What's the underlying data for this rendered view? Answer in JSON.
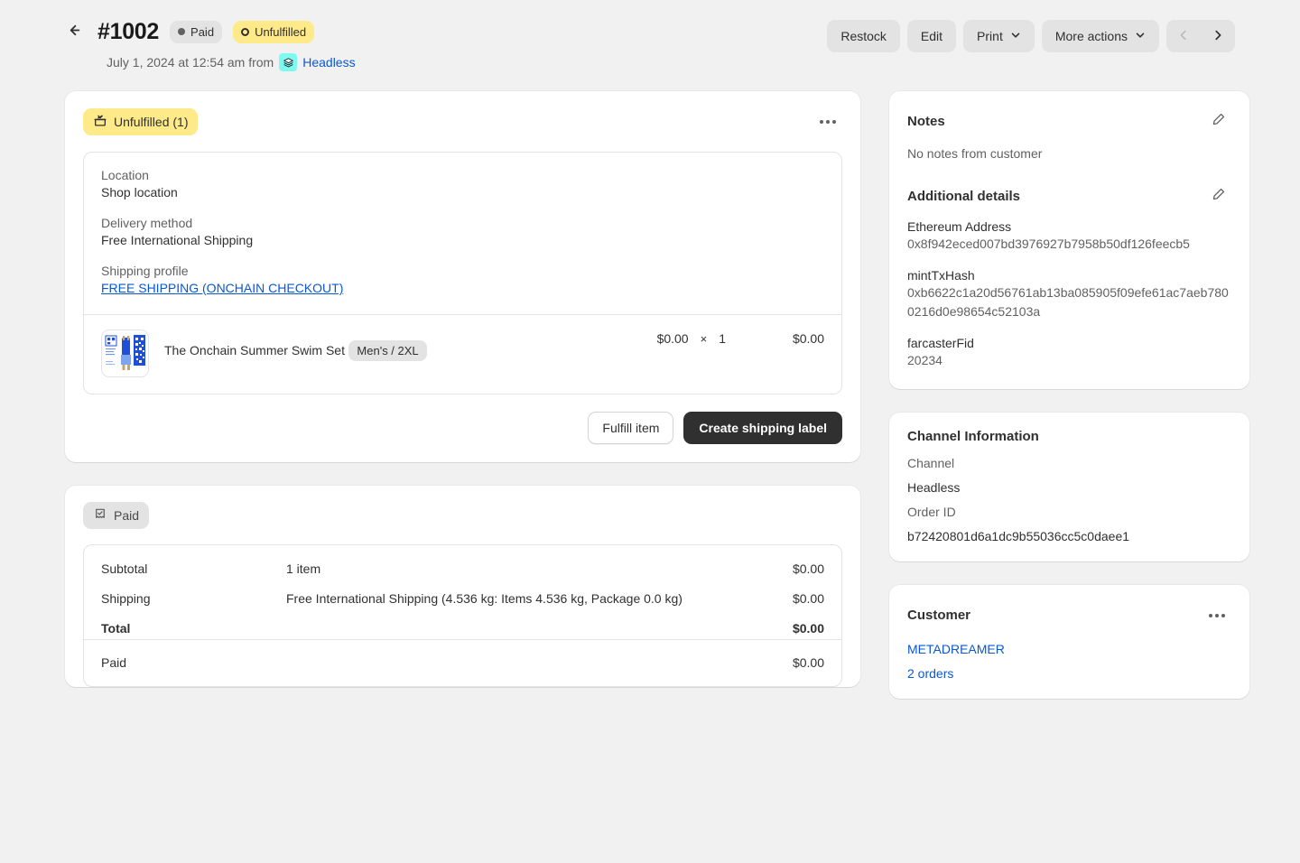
{
  "header": {
    "back_icon": "arrow-left-icon",
    "order_number": "#1002",
    "payment_badge": "Paid",
    "fulfillment_badge": "Unfulfilled",
    "date_text": "July 1, 2024 at 12:54 am from",
    "channel_name": "Headless",
    "channel_icon": "layers-icon",
    "actions": {
      "restock": "Restock",
      "edit": "Edit",
      "print": "Print",
      "more_actions": "More actions",
      "prev_icon": "chevron-left-icon",
      "next_icon": "chevron-right-icon"
    }
  },
  "fulfillment": {
    "status_badge": "Unfulfilled (1)",
    "status_icon": "package-x-icon",
    "overflow_icon": "kebab-menu-icon",
    "location_label": "Location",
    "location_value": "Shop location",
    "delivery_label": "Delivery method",
    "delivery_value": "Free International Shipping",
    "shipping_profile_label": "Shipping profile",
    "shipping_profile_value": "FREE SHIPPING (ONCHAIN CHECKOUT)",
    "item": {
      "title": "The Onchain Summer Swim Set",
      "variant": "Men's / 2XL",
      "unit_price": "$0.00",
      "multiply": "×",
      "quantity": "1",
      "line_total": "$0.00",
      "image_alt": "product-thumbnail"
    },
    "fulfill_button": "Fulfill item",
    "shipping_label_button": "Create shipping label"
  },
  "payment": {
    "status_badge": "Paid",
    "status_icon": "receipt-check-icon",
    "rows": [
      {
        "label": "Subtotal",
        "description": "1 item",
        "amount": "$0.00"
      },
      {
        "label": "Shipping",
        "description": "Free International Shipping (4.536 kg: Items 4.536 kg, Package 0.0 kg)",
        "amount": "$0.00"
      },
      {
        "label": "Total",
        "description": "",
        "amount": "$0.00"
      }
    ],
    "paid_label": "Paid",
    "paid_amount": "$0.00"
  },
  "sidebar": {
    "notes": {
      "title": "Notes",
      "edit_icon": "pencil-icon",
      "empty_text": "No notes from customer"
    },
    "additional_details": {
      "title": "Additional details",
      "edit_icon": "pencil-icon",
      "items": [
        {
          "key": "Ethereum Address",
          "value": "0x8f942eced007bd3976927b7958b50df126feecb5"
        },
        {
          "key": "mintTxHash",
          "value": "0xb6622c1a20d56761ab13ba085905f09efe61ac7aeb7800216d0e98654c52103a"
        },
        {
          "key": "farcasterFid",
          "value": "20234"
        }
      ]
    },
    "channel_information": {
      "title": "Channel Information",
      "channel_label": "Channel",
      "channel_value": "Headless",
      "order_id_label": "Order ID",
      "order_id_value": "b72420801d6a1dc9b55036cc5c0daee1"
    },
    "customer": {
      "title": "Customer",
      "overflow_icon": "kebab-menu-icon",
      "name": "METADREAMER",
      "orders_count": "2 orders"
    }
  },
  "colors": {
    "page_background": "#f1f1f1",
    "card_background": "#ffffff",
    "accent_yellow": "#ffea8a",
    "link_blue": "#0a58d0",
    "primary_button": "#303030",
    "channel_chip": "#7efbf0"
  }
}
